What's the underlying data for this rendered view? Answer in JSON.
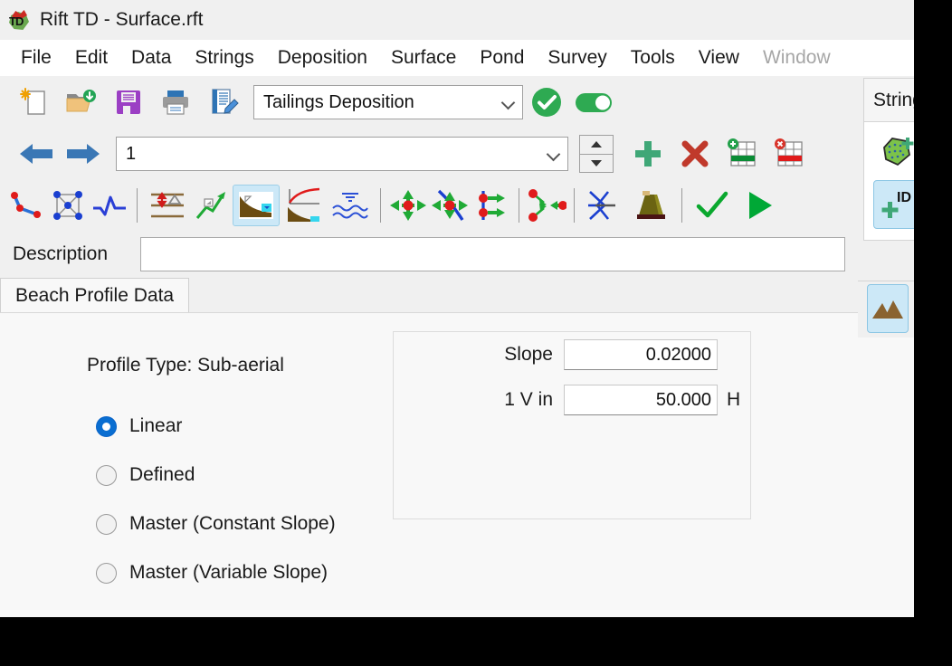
{
  "window": {
    "title": "Rift TD - Surface.rft",
    "logo_icon": "app-logo-td"
  },
  "menubar": {
    "items": [
      {
        "label": "File",
        "disabled": false
      },
      {
        "label": "Edit",
        "disabled": false
      },
      {
        "label": "Data",
        "disabled": false
      },
      {
        "label": "Strings",
        "disabled": false
      },
      {
        "label": "Deposition",
        "disabled": false
      },
      {
        "label": "Surface",
        "disabled": false
      },
      {
        "label": "Pond",
        "disabled": false
      },
      {
        "label": "Survey",
        "disabled": false
      },
      {
        "label": "Tools",
        "disabled": false
      },
      {
        "label": "View",
        "disabled": false
      },
      {
        "label": "Window",
        "disabled": true
      }
    ]
  },
  "toolbar_file": {
    "buttons": [
      {
        "icon": "new-document-icon"
      },
      {
        "icon": "open-folder-icon"
      },
      {
        "icon": "save-floppy-icon"
      },
      {
        "icon": "print-icon"
      },
      {
        "icon": "edit-notes-icon"
      }
    ],
    "mode_combo": {
      "value": "Tailings Deposition",
      "chevron": "chevron-down-icon"
    },
    "apply_icon": "green-check-circle-icon",
    "toggle_icon": "toggle-on-icon"
  },
  "toolbar_nav": {
    "prev_icon": "arrow-left-icon",
    "next_icon": "arrow-right-icon",
    "index_combo": {
      "value": "1",
      "chevron": "chevron-down-icon"
    },
    "spinner": {
      "up": "spinner-up-icon",
      "down": "spinner-down-icon"
    },
    "add_icon": "plus-icon",
    "delete_icon": "cross-icon",
    "add_row_icon": "add-table-row-icon",
    "delete_row_icon": "delete-table-row-icon"
  },
  "toolbar_tools": {
    "buttons": [
      {
        "icon": "polyline-icon",
        "selected": false
      },
      {
        "icon": "mesh-node-icon",
        "selected": false
      },
      {
        "icon": "waveform-icon",
        "selected": false
      },
      {
        "icon": "elevation-delta-icon",
        "selected": false
      },
      {
        "icon": "slope-arrow-icon",
        "selected": false
      },
      {
        "icon": "beach-profile-icon",
        "selected": true
      },
      {
        "icon": "profile-curve-icon",
        "selected": false
      },
      {
        "icon": "water-waves-icon",
        "selected": false
      },
      {
        "icon": "move-node-icon",
        "selected": false
      },
      {
        "icon": "move-on-curve-icon",
        "selected": false
      },
      {
        "icon": "offset-nodes-icon",
        "selected": false
      },
      {
        "icon": "converge-nodes-icon",
        "selected": false
      },
      {
        "icon": "intersection-icon",
        "selected": false
      },
      {
        "icon": "embankment-icon",
        "selected": false
      },
      {
        "icon": "accept-check-icon",
        "selected": false
      },
      {
        "icon": "run-play-icon",
        "selected": false
      }
    ]
  },
  "description": {
    "label": "Description",
    "value": "",
    "placeholder": ""
  },
  "tabs": [
    {
      "label": "Beach Profile Data",
      "selected": true
    }
  ],
  "page": {
    "profile_type": "Profile Type: Sub-aerial",
    "radios": [
      {
        "label": "Linear",
        "selected": true
      },
      {
        "label": "Defined",
        "selected": false
      },
      {
        "label": "Master (Constant Slope)",
        "selected": false
      },
      {
        "label": "Master (Variable Slope)",
        "selected": false
      }
    ],
    "fields": [
      {
        "label": "Slope",
        "value": "0.02000",
        "suffix": ""
      },
      {
        "label": "1 V in",
        "value": "50.000",
        "suffix": "H"
      }
    ]
  },
  "dock": {
    "header": "String",
    "buttons": [
      {
        "icon": "add-polygon-icon",
        "selected": false
      },
      {
        "icon": "add-id-icon",
        "selected": true
      }
    ],
    "strip_buttons": [
      {
        "icon": "terrain-mountains-icon",
        "selected": true
      },
      {
        "icon": "intersection-blue-icon",
        "selected": false
      }
    ]
  },
  "colors": {
    "accent_blue": "#0a6ed1",
    "selected_tool_bg": "#cce8f7",
    "green": "#2eaa52",
    "red": "#c0392b",
    "panel_bg": "#f0f0f0",
    "page_bg": "#f8f8f8"
  }
}
